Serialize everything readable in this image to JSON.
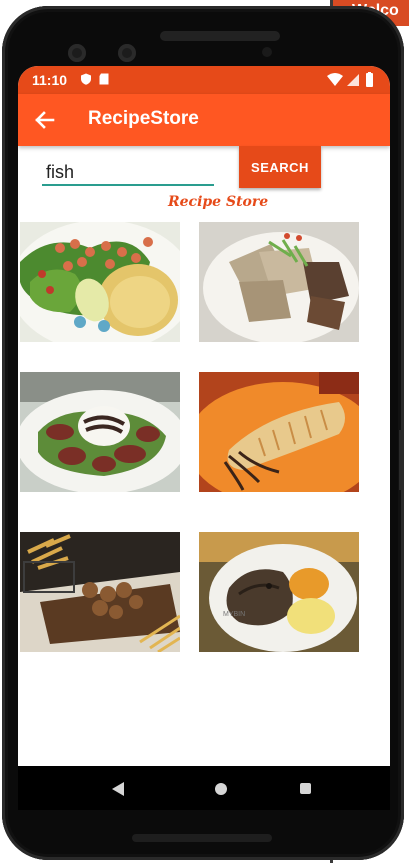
{
  "background_window": {
    "title": "Welco"
  },
  "status_bar": {
    "time": "11:10"
  },
  "app_bar": {
    "title": "RecipeStore",
    "back_icon": "arrow-back-icon"
  },
  "search": {
    "value": "fish",
    "button_label": "SEARCH"
  },
  "brand": "Recipe Store",
  "colors": {
    "primary": "#ff5722",
    "primary_dark": "#e64a19",
    "input_underline": "#2a9d8f"
  },
  "recipes": [
    {
      "name": "shrimp-rice-salad-image"
    },
    {
      "name": "tofu-scallion-plate-image"
    },
    {
      "name": "beef-salad-cheese-image"
    },
    {
      "name": "stuffed-squid-image"
    },
    {
      "name": "mushroom-steak-fries-image"
    },
    {
      "name": "fish-head-mash-image"
    }
  ],
  "navigation": {
    "back": "nav-back-icon",
    "home": "nav-home-icon",
    "recent": "nav-recents-icon"
  }
}
